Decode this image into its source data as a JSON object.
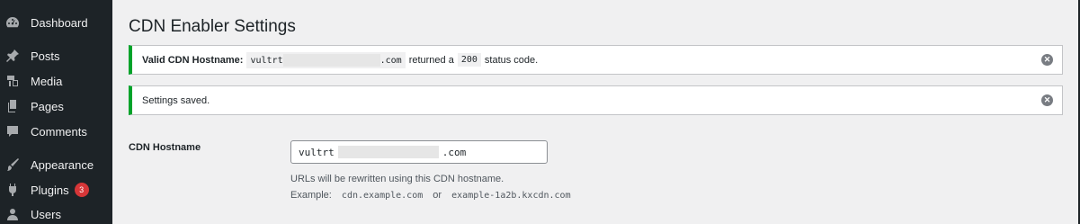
{
  "sidebar": {
    "items": [
      {
        "label": "Dashboard",
        "icon": "dashboard-icon"
      },
      {
        "label": "Posts",
        "icon": "pin-icon"
      },
      {
        "label": "Media",
        "icon": "media-icon"
      },
      {
        "label": "Pages",
        "icon": "page-icon"
      },
      {
        "label": "Comments",
        "icon": "comment-icon"
      },
      {
        "label": "Appearance",
        "icon": "brush-icon"
      },
      {
        "label": "Plugins",
        "icon": "plugin-icon",
        "badge": "3"
      },
      {
        "label": "Users",
        "icon": "user-icon"
      }
    ]
  },
  "page": {
    "title": "CDN Enabler Settings"
  },
  "notices": [
    {
      "prefix": "Valid CDN Hostname:",
      "host_start": "vultrt",
      "host_end": ".com",
      "mid": "returned a",
      "code": "200",
      "suffix": "status code."
    },
    {
      "text": "Settings saved."
    }
  ],
  "form": {
    "cdn_label": "CDN Hostname",
    "cdn_value_start": "vultrt",
    "cdn_value_end": ".com",
    "desc1": "URLs will be rewritten using this CDN hostname.",
    "example_label": "Example:",
    "example1": "cdn.example.com",
    "or": "or",
    "example2": "example-1a2b.kxcdn.com"
  },
  "colors": {
    "sidebar_bg": "#1d2327",
    "notice_success": "#00a32a",
    "badge": "#d63638"
  }
}
